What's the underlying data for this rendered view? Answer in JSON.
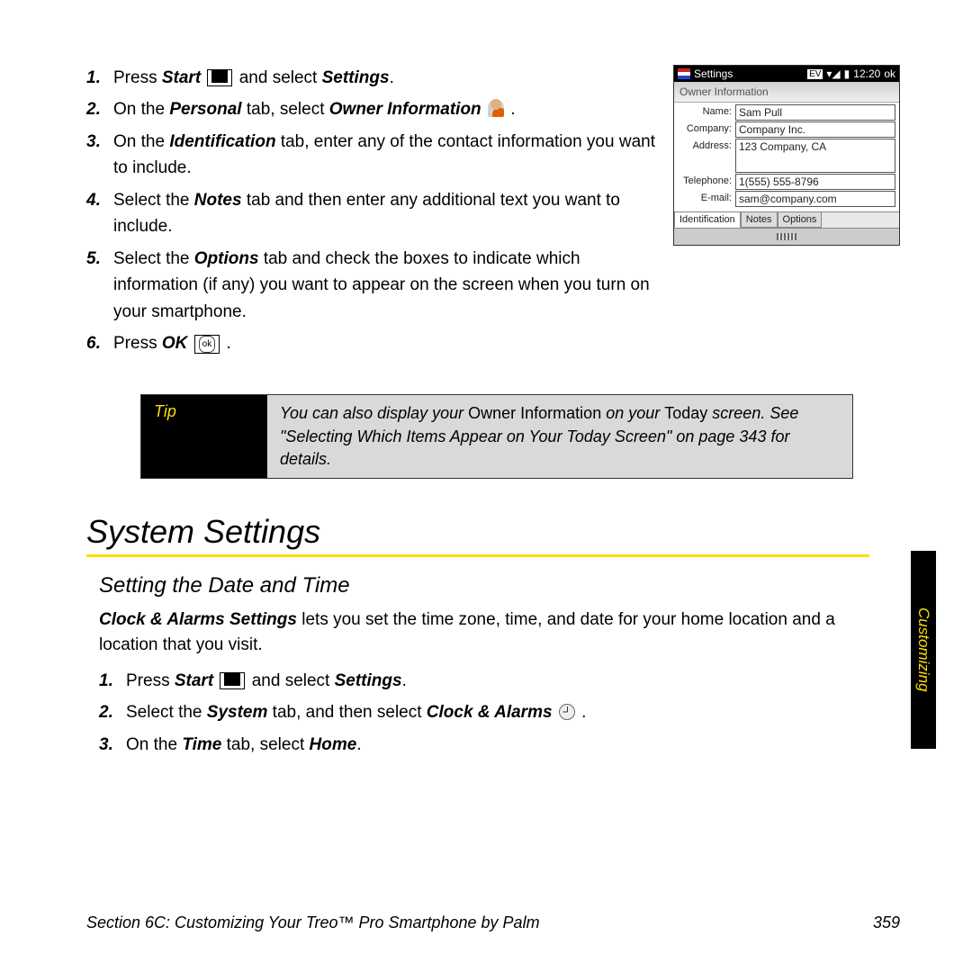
{
  "steps_top": [
    {
      "num": "1.",
      "parts": [
        "Press ",
        {
          "bi": "Start"
        },
        " ",
        {
          "iconbox_start": true
        },
        " and select ",
        {
          "bi": "Settings"
        },
        "."
      ]
    },
    {
      "num": "2.",
      "parts": [
        "On the ",
        {
          "bi": "Personal"
        },
        " tab, select ",
        {
          "bi": "Owner Information"
        },
        " ",
        {
          "person": true
        },
        " ."
      ]
    },
    {
      "num": "3.",
      "parts": [
        "On the ",
        {
          "bi": "Identification"
        },
        " tab, enter any of the contact information you want to include."
      ]
    },
    {
      "num": "4.",
      "parts": [
        "Select the ",
        {
          "bi": "Notes"
        },
        " tab and then enter any additional text you want to include."
      ]
    },
    {
      "num": "5.",
      "parts": [
        "Select the ",
        {
          "bi": "Options"
        },
        " tab and check the boxes to indicate which information (if any) you want to appear on the screen when you turn on your smartphone."
      ]
    },
    {
      "num": "6.",
      "parts": [
        "Press ",
        {
          "bi": "OK"
        },
        " ",
        {
          "iconbox_ok": true
        },
        " ."
      ]
    }
  ],
  "shot": {
    "title": "Settings",
    "badge": "EV",
    "time": "12:20",
    "ok": "ok",
    "header": "Owner Information",
    "rows": [
      {
        "label": "Name:",
        "value": "Sam Pull"
      },
      {
        "label": "Company:",
        "value": "Company Inc."
      },
      {
        "label": "Address:",
        "value": "123 Company, CA",
        "tall": true
      },
      {
        "label": "Telephone:",
        "value": "1(555) 555-8796"
      },
      {
        "label": "E-mail:",
        "value": "sam@company.com"
      }
    ],
    "tabs": [
      "Identification",
      "Notes",
      "Options"
    ]
  },
  "tip": {
    "label": "Tip",
    "text_before": "You can also display your ",
    "upright1": "Owner Information",
    "text_mid": " on your ",
    "upright2": "Today",
    "text_after": " screen. See \"Selecting Which Items Appear on Your Today Screen\" on page 343 for details."
  },
  "h1": "System Settings",
  "h2": "Setting the Date and Time",
  "para_parts": [
    {
      "bi": "Clock & Alarms Settings"
    },
    " lets you set the time zone, time, and date for your home location and a location that you visit."
  ],
  "steps_bottom": [
    {
      "num": "1.",
      "parts": [
        "Press ",
        {
          "bi": "Start"
        },
        " ",
        {
          "iconbox_start": true
        },
        " and select ",
        {
          "bi": "Settings"
        },
        "."
      ]
    },
    {
      "num": "2.",
      "parts": [
        "Select the ",
        {
          "bi": "System"
        },
        " tab, and then select ",
        {
          "bi": "Clock & Alarms"
        },
        " ",
        {
          "clock": true
        },
        " ."
      ]
    },
    {
      "num": "3.",
      "parts": [
        "On the ",
        {
          "bi": "Time"
        },
        " tab, select ",
        {
          "bi": "Home"
        },
        "."
      ]
    }
  ],
  "side_tab": "Customizing",
  "footer_left": "Section 6C: Customizing Your Treo™ Pro Smartphone by Palm",
  "footer_right": "359"
}
